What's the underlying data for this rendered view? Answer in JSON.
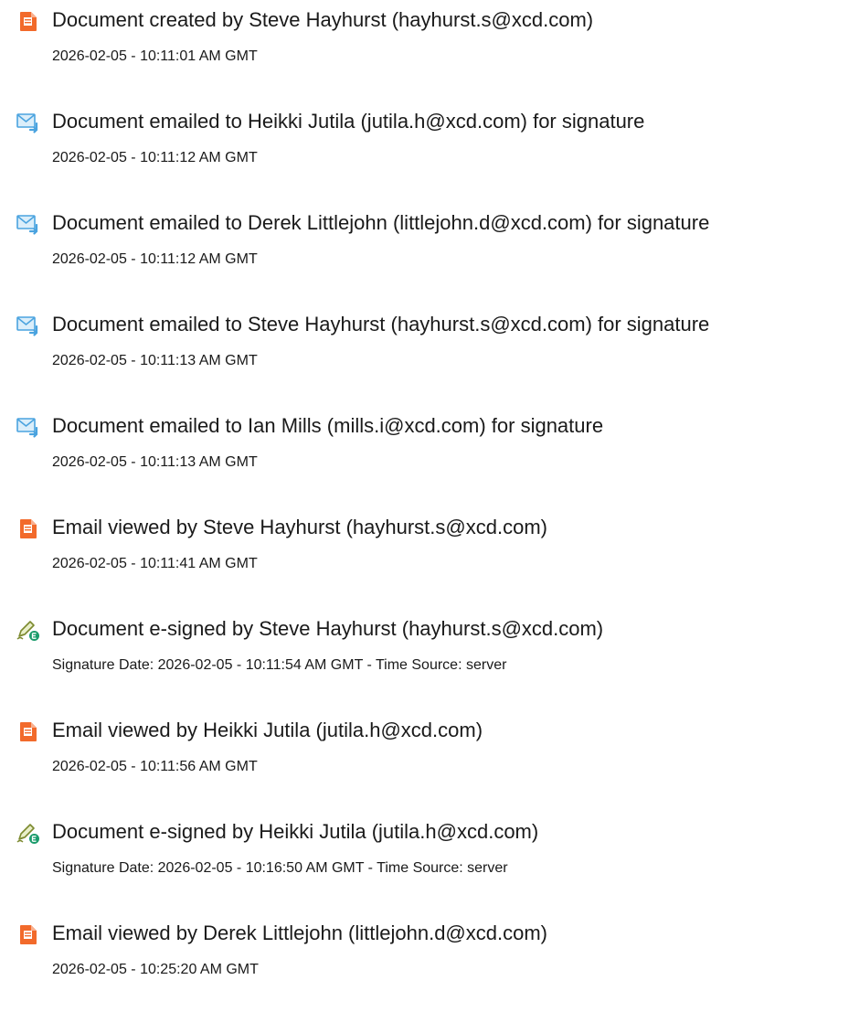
{
  "audit_log": {
    "entries": [
      {
        "icon": "document-created-icon",
        "title": "Document created by Steve Hayhurst (hayhurst.s@xcd.com)",
        "meta": "2026-02-05 - 10:11:01 AM GMT"
      },
      {
        "icon": "email-sent-icon",
        "title": "Document emailed to Heikki Jutila (jutila.h@xcd.com) for signature",
        "meta": "2026-02-05 - 10:11:12 AM GMT"
      },
      {
        "icon": "email-sent-icon",
        "title": "Document emailed to Derek Littlejohn (littlejohn.d@xcd.com) for signature",
        "meta": "2026-02-05 - 10:11:12 AM GMT"
      },
      {
        "icon": "email-sent-icon",
        "title": "Document emailed to Steve Hayhurst (hayhurst.s@xcd.com) for signature",
        "meta": "2026-02-05 - 10:11:13 AM GMT"
      },
      {
        "icon": "email-sent-icon",
        "title": "Document emailed to Ian Mills (mills.i@xcd.com) for signature",
        "meta": "2026-02-05 - 10:11:13 AM GMT"
      },
      {
        "icon": "email-viewed-icon",
        "title": "Email viewed by Steve Hayhurst (hayhurst.s@xcd.com)",
        "meta": "2026-02-05 - 10:11:41 AM GMT"
      },
      {
        "icon": "e-signature-icon",
        "title": "Document e-signed by Steve Hayhurst (hayhurst.s@xcd.com)",
        "meta": "Signature Date: 2026-02-05 - 10:11:54 AM GMT - Time Source: server"
      },
      {
        "icon": "email-viewed-icon",
        "title": "Email viewed by Heikki Jutila (jutila.h@xcd.com)",
        "meta": "2026-02-05 - 10:11:56 AM GMT"
      },
      {
        "icon": "e-signature-icon",
        "title": "Document e-signed by Heikki Jutila (jutila.h@xcd.com)",
        "meta": "Signature Date: 2026-02-05 - 10:16:50 AM GMT - Time Source: server"
      },
      {
        "icon": "email-viewed-icon",
        "title": "Email viewed by Derek Littlejohn (littlejohn.d@xcd.com)",
        "meta": "2026-02-05 - 10:25:20 AM GMT"
      }
    ]
  },
  "colors": {
    "document_icon": "#f26a2b",
    "email_icon": "#4aa3df",
    "signature_icon_pen": "#7c8a2f",
    "signature_icon_badge": "#1a9b6b"
  }
}
